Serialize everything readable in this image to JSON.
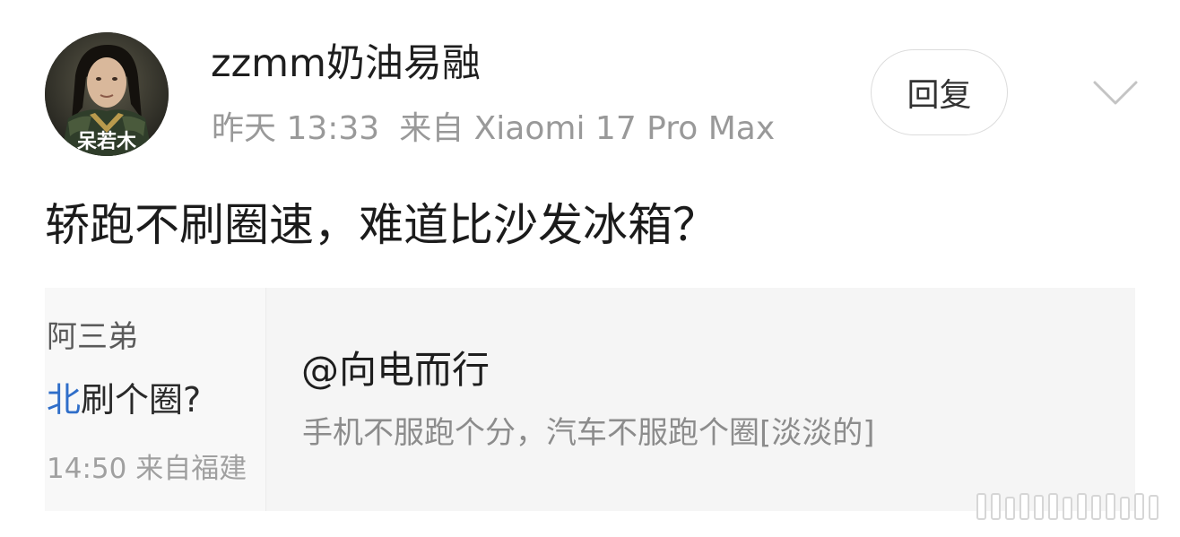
{
  "post": {
    "username": "zzmm奶油易融",
    "time": "昨天 13:33",
    "source": "来自 Xiaomi 17 Pro Max",
    "reply_label": "回复",
    "text": "轿跑不刷圈速，难道比沙发冰箱？"
  },
  "avatar": {
    "caption": "呆若木"
  },
  "quote": {
    "thumbnail": {
      "name": "阿三弟",
      "text_highlight": "北",
      "text_rest": "刷个圈?",
      "meta": "14:50 来自福建"
    },
    "title": "@向电而行",
    "body": "手机不服跑个分，汽车不服跑个圈[淡淡的]"
  },
  "colors": {
    "meta_gray": "#999999",
    "card_bg": "#f5f5f5",
    "link_blue": "#2f6ec9"
  },
  "icons": {
    "expand": "chevron-down-icon",
    "avatar": "avatar-portrait"
  }
}
